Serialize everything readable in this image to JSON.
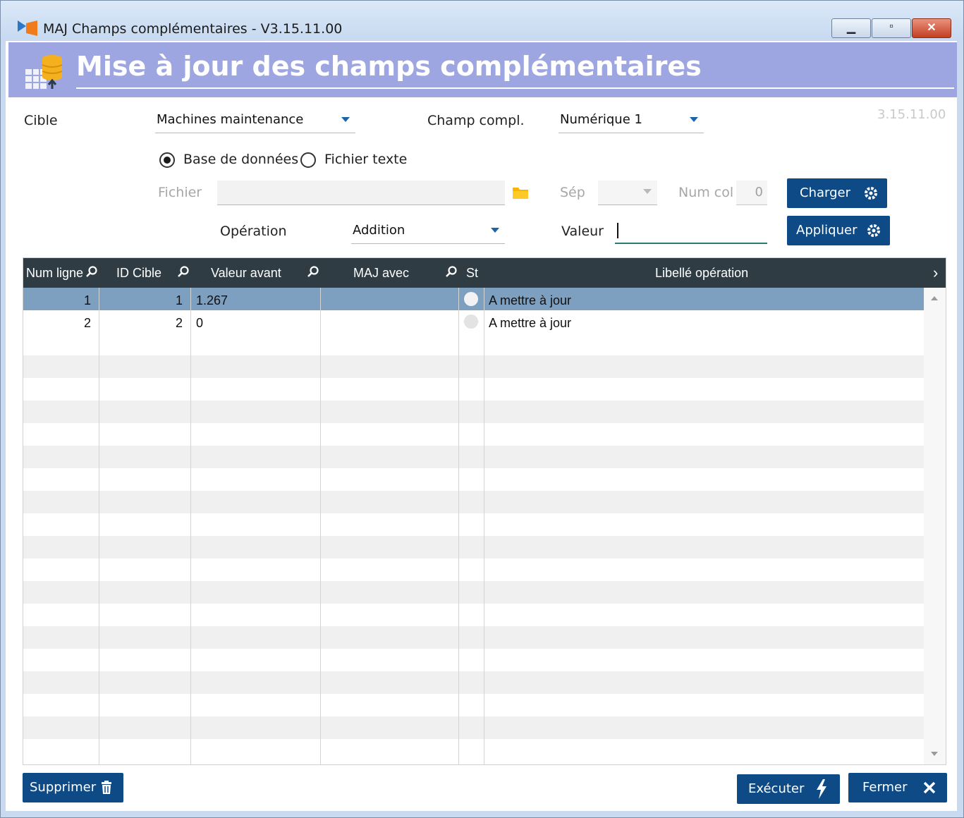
{
  "window": {
    "title": "MAJ Champs complémentaires - V3.15.11.00",
    "controls": [
      "minimize",
      "maximize",
      "close"
    ]
  },
  "banner": {
    "title": "Mise à jour des champs complémentaires"
  },
  "version_label": "3.15.11.00",
  "form": {
    "cible_label": "Cible",
    "cible_value": "Machines maintenance",
    "champ_label": "Champ compl.",
    "champ_value": "Numérique 1",
    "source_db_label": "Base de données",
    "source_file_label": "Fichier texte",
    "source_selected": "Base de données",
    "fichier_label": "Fichier",
    "fichier_value": "",
    "sep_label": "Sép",
    "sep_value": "",
    "numcol_label": "Num col",
    "numcol_value": "0",
    "operation_label": "Opération",
    "operation_value": "Addition",
    "valeur_label": "Valeur",
    "valeur_value": "",
    "charger_label": "Charger",
    "appliquer_label": "Appliquer"
  },
  "grid": {
    "columns": [
      "Num ligne",
      "ID Cible",
      "Valeur avant",
      "MAJ avec",
      "St",
      "Libellé opération"
    ],
    "rows": [
      {
        "num": "1",
        "id": "1",
        "avant": "1.267",
        "maj": "",
        "libelle": "A mettre à jour",
        "selected": true
      },
      {
        "num": "2",
        "id": "2",
        "avant": "0",
        "maj": "",
        "libelle": "A mettre à jour",
        "selected": false
      }
    ]
  },
  "footer": {
    "supprimer_label": "Supprimer",
    "executer_label": "Exécuter",
    "fermer_label": "Fermer"
  },
  "colors": {
    "banner": "#9da6e0",
    "button": "#0d4a86",
    "grid_header": "#2f3c44",
    "selected_row": "#7d9fc0"
  },
  "icons": [
    "app-icon",
    "database-grid-icon",
    "folder-icon",
    "gear-icon",
    "search-icon",
    "trash-icon",
    "lightning-icon",
    "close-x-icon",
    "chevron-right-icon"
  ]
}
